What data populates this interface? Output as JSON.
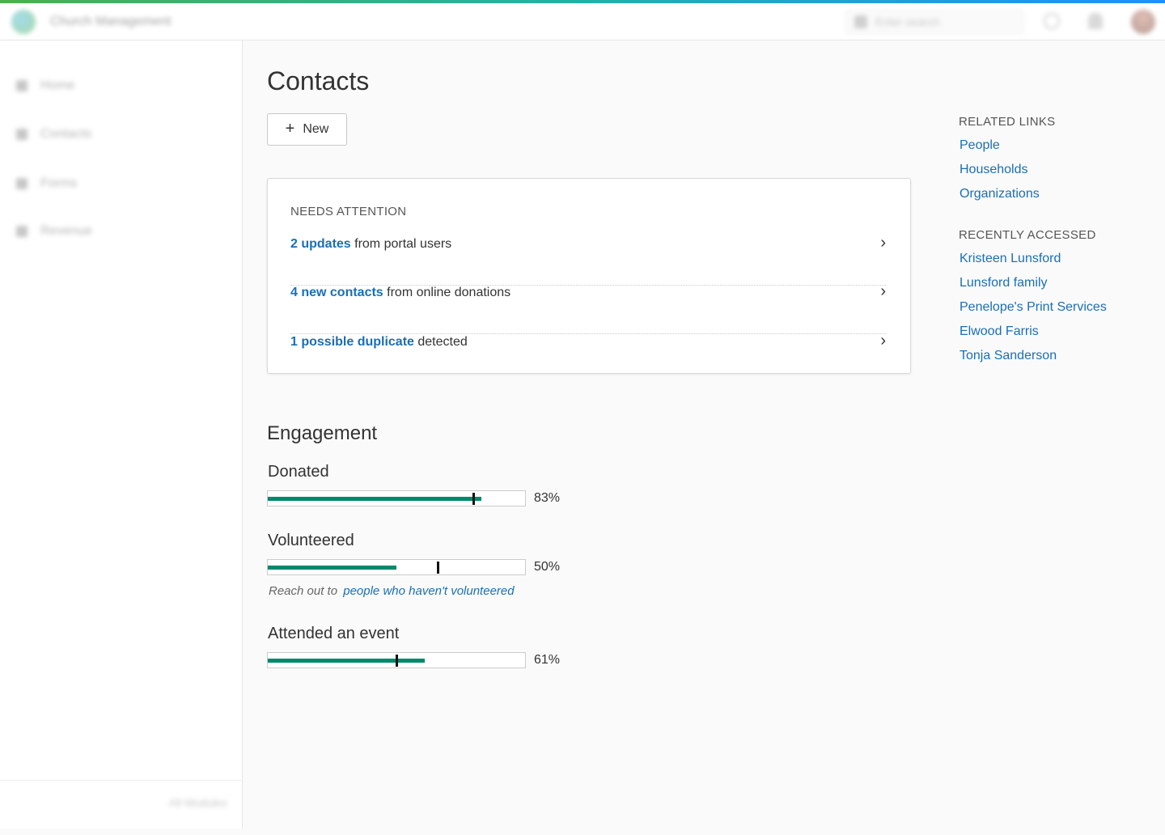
{
  "app": {
    "title": "Church Management"
  },
  "header": {
    "search_placeholder": "Enter search"
  },
  "sidebar": {
    "items": [
      {
        "label": "Home"
      },
      {
        "label": "Contacts"
      },
      {
        "label": "Forms"
      },
      {
        "label": "Revenue"
      }
    ],
    "footer": "All Modules"
  },
  "main": {
    "title": "Contacts",
    "new_label": "New",
    "needs_attention": {
      "heading": "NEEDS ATTENTION",
      "items": [
        {
          "strong": "2 updates",
          "rest": " from portal users"
        },
        {
          "strong": "4 new contacts",
          "rest": " from online donations"
        },
        {
          "strong": "1 possible duplicate",
          "rest": " detected"
        }
      ]
    },
    "engagement": {
      "title": "Engagement",
      "metrics": [
        {
          "label": "Donated",
          "value_text": "83%",
          "fill": 0.83,
          "benchmark": 0.8
        },
        {
          "label": "Volunteered",
          "value_text": "50%",
          "fill": 0.5,
          "benchmark": 0.66
        },
        {
          "label": "Attended an event",
          "value_text": "61%",
          "fill": 0.61,
          "benchmark": 0.5
        }
      ],
      "volunteer_prompt": "Reach out to",
      "volunteer_link": "people who haven't volunteered"
    }
  },
  "rail": {
    "related_heading": "RELATED LINKS",
    "related": [
      "People",
      "Households",
      "Organizations"
    ],
    "recent_heading": "RECENTLY ACCESSED",
    "recent": [
      "Kristeen Lunsford",
      "Lunsford family",
      "Penelope's Print Services",
      "Elwood Farris",
      "Tonja Sanderson"
    ]
  },
  "colors": {
    "accent_link": "#1a6fb5",
    "bar_fill": "#00896b"
  }
}
